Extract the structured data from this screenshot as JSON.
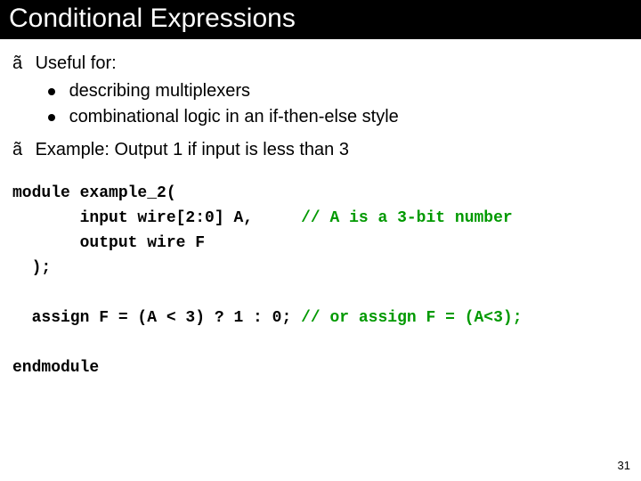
{
  "title": "Conditional Expressions",
  "bullets": {
    "b1": {
      "marker": "ã",
      "text": "Useful for:",
      "sub": [
        "describing multiplexers",
        "combinational logic in an if-then-else style"
      ]
    },
    "b2": {
      "marker": "ã",
      "text": "Example:  Output 1 if input is less than 3"
    }
  },
  "code": {
    "l1": "module example_2(",
    "l2": "       input wire[2:0] A,     ",
    "l2c": "// A is a 3-bit number",
    "l3": "       output wire F",
    "l4": "  );",
    "blank1": "",
    "l5": "  assign F = (A < 3) ? 1 : 0; ",
    "l5c": "// or assign F = (A<3);",
    "blank2": "",
    "l6": "endmodule"
  },
  "page": "31"
}
